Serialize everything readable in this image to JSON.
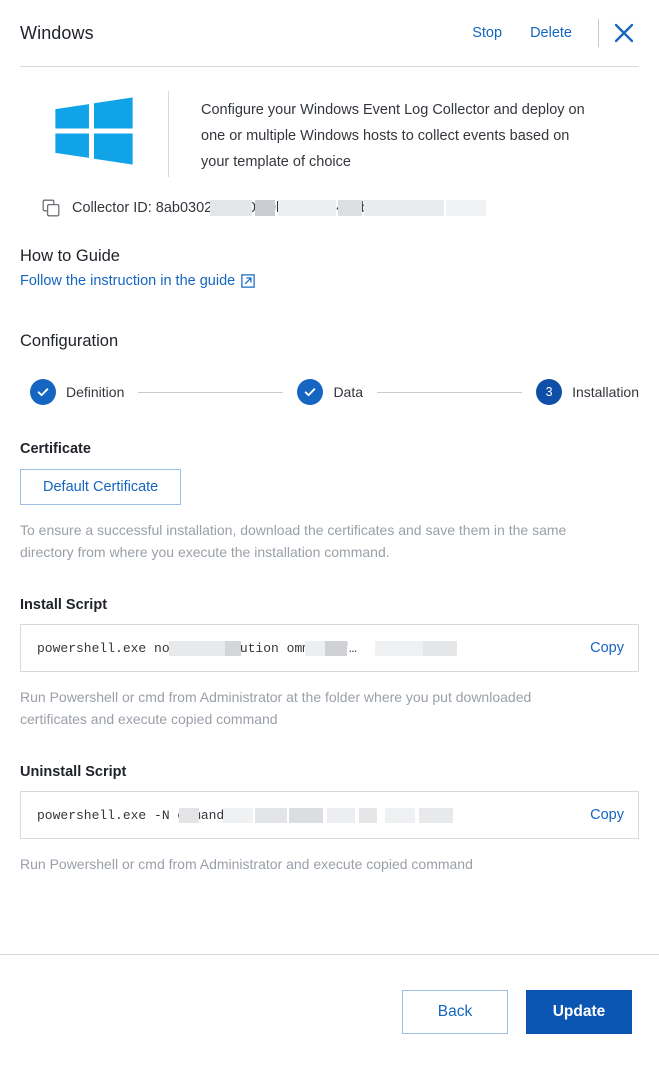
{
  "header": {
    "title": "Windows",
    "stop_label": "Stop",
    "delete_label": "Delete",
    "close_icon": "close-icon"
  },
  "intro": {
    "logo_icon": "windows-logo-icon",
    "description": "Configure your Windows Event Log Collector and deploy on one or multiple Windows hosts to collect events based on your template of choice",
    "collector_id_label": "Collector ID: 8ab03020  c1b0  40ba  00/4  44u0bad0i7 22",
    "copy_icon": "copy-icon"
  },
  "how_to": {
    "heading": "How to Guide",
    "link_label": "Follow the instruction in the guide",
    "external_icon": "external-link-icon"
  },
  "configuration": {
    "heading": "Configuration",
    "steps": [
      {
        "label": "Definition",
        "state": "complete",
        "marker": "✓"
      },
      {
        "label": "Data",
        "state": "complete",
        "marker": "✓"
      },
      {
        "label": "Installation",
        "state": "current",
        "marker": "3"
      }
    ]
  },
  "certificate": {
    "label": "Certificate",
    "button_label": "Default Certificate",
    "hint": "To ensure a successful installation, download the certificates and save them in the same directory from where you execute the installation command."
  },
  "install_script": {
    "label": "Install Script",
    "value": "powershell.exe  noLogo  Execution            ommand \"…",
    "copy_label": "Copy",
    "hint": "Run Powershell or cmd from Administrator at the folder where you put downloaded certificates and execute copied command"
  },
  "uninstall_script": {
    "label": "Uninstall Script",
    "value": "powershell.exe -N                                 ommand \"…",
    "copy_label": "Copy",
    "hint": "Run Powershell or cmd from Administrator and execute copied command"
  },
  "footer": {
    "back_label": "Back",
    "update_label": "Update"
  },
  "colors": {
    "link_blue": "#1566c0",
    "primary_blue": "#0b55b3",
    "step_blue": "#1566c0",
    "step_current_blue": "#0f4fa8",
    "windows_logo_blue": "#10a3e8",
    "muted_text": "#9aa0a8",
    "border": "#d6dae0"
  }
}
